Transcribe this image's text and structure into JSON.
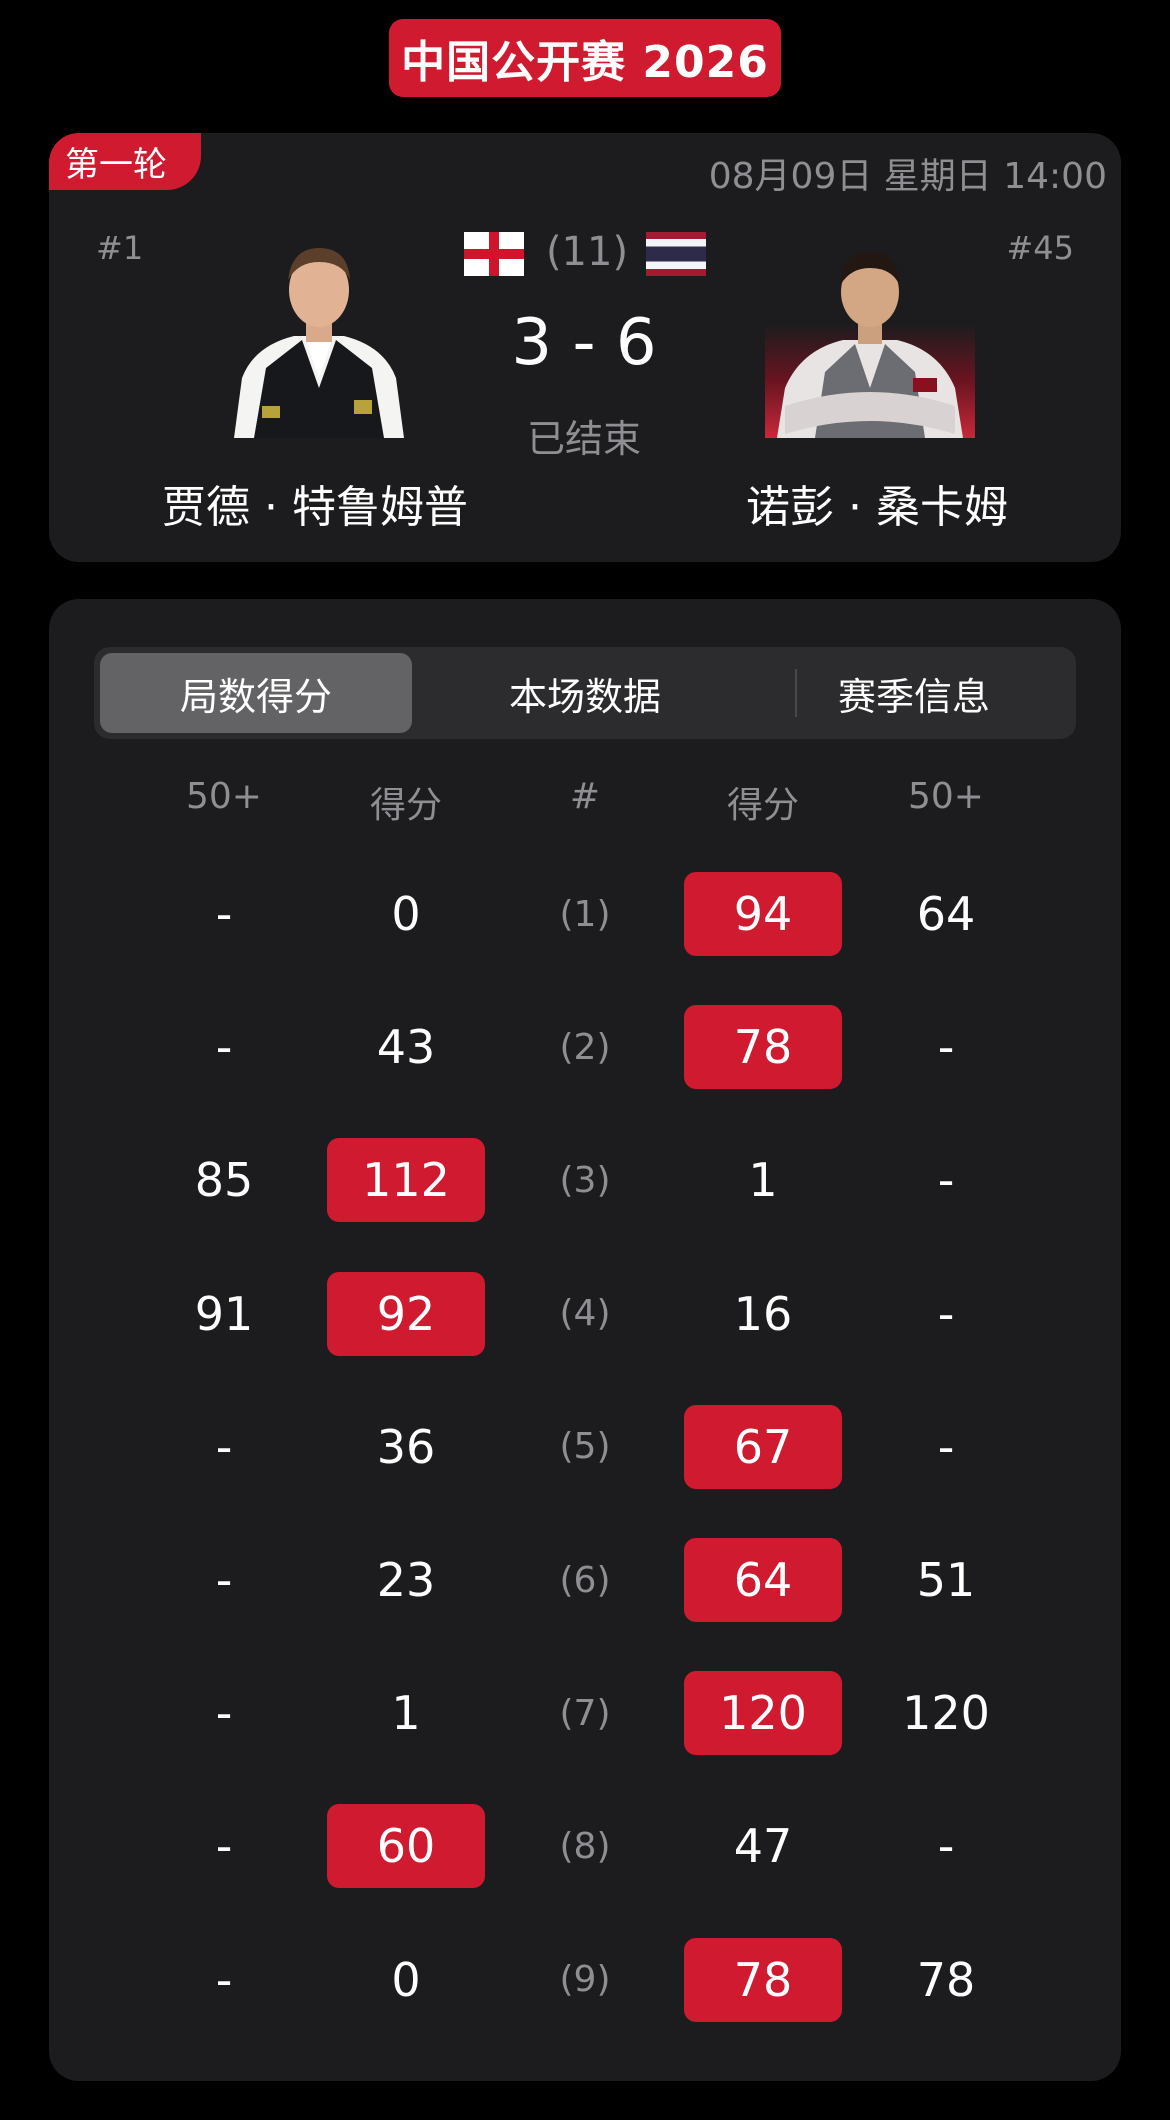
{
  "header": {
    "tournament_title": "中国公开赛 2026"
  },
  "match": {
    "round": "第一轮",
    "datetime": "08月09日 星期日 14:00",
    "best_of": "(11)",
    "score": "3 - 6",
    "status": "已结束",
    "player_left": {
      "rank": "#1",
      "name": "贾德 · 特鲁姆普",
      "flag": "england-flag"
    },
    "player_right": {
      "rank": "#45",
      "name": "诺彭 · 桑卡姆",
      "flag": "thailand-flag"
    }
  },
  "tabs": [
    {
      "label": "局数得分",
      "active": true
    },
    {
      "label": "本场数据",
      "active": false
    },
    {
      "label": "赛季信息",
      "active": false
    }
  ],
  "table": {
    "columns": [
      "50+",
      "得分",
      "#",
      "得分",
      "50+"
    ],
    "frames": [
      {
        "left_break": "-",
        "left_score": "0",
        "frame": "(1)",
        "right_score": "94",
        "right_break": "64",
        "winner": "right"
      },
      {
        "left_break": "-",
        "left_score": "43",
        "frame": "(2)",
        "right_score": "78",
        "right_break": "-",
        "winner": "right"
      },
      {
        "left_break": "85",
        "left_score": "112",
        "frame": "(3)",
        "right_score": "1",
        "right_break": "-",
        "winner": "left"
      },
      {
        "left_break": "91",
        "left_score": "92",
        "frame": "(4)",
        "right_score": "16",
        "right_break": "-",
        "winner": "left"
      },
      {
        "left_break": "-",
        "left_score": "36",
        "frame": "(5)",
        "right_score": "67",
        "right_break": "-",
        "winner": "right"
      },
      {
        "left_break": "-",
        "left_score": "23",
        "frame": "(6)",
        "right_score": "64",
        "right_break": "51",
        "winner": "right"
      },
      {
        "left_break": "-",
        "left_score": "1",
        "frame": "(7)",
        "right_score": "120",
        "right_break": "120",
        "winner": "right"
      },
      {
        "left_break": "-",
        "left_score": "60",
        "frame": "(8)",
        "right_score": "47",
        "right_break": "-",
        "winner": "left"
      },
      {
        "left_break": "-",
        "left_score": "0",
        "frame": "(9)",
        "right_score": "78",
        "right_break": "78",
        "winner": "right"
      }
    ]
  },
  "colors": {
    "accent_red": "#d01a30",
    "card_bg": "#1c1c1e",
    "muted_text": "#8e8e93",
    "page_bg": "#000000"
  }
}
